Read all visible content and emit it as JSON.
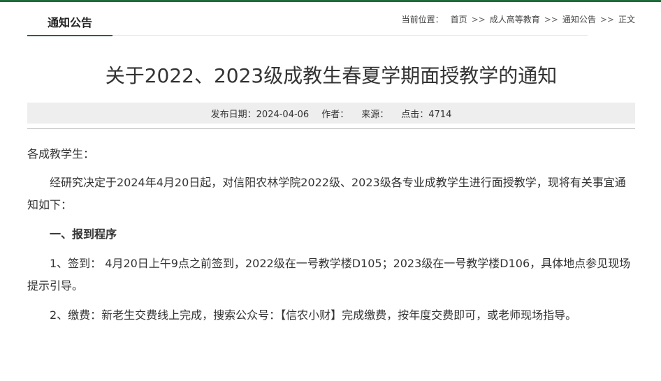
{
  "header": {
    "section_tab": "通知公告",
    "breadcrumb": {
      "prefix": "当前位置：",
      "items": [
        "首页",
        "成人高等教育",
        "通知公告",
        "正文"
      ],
      "separator": ">>"
    }
  },
  "article": {
    "title": "关于2022、2023级成教生春夏学期面授教学的通知",
    "meta": {
      "publish_date": "发布日期：2024-04-06",
      "author": "作者：",
      "source": "来源：",
      "clicks": "点击：4714"
    },
    "paragraphs": {
      "salutation": "各成教学生：",
      "intro": "经研究决定于2024年4月20日起，对信阳农林学院2022级、2023级各专业成教学生进行面授教学，现将有关事宜通知如下：",
      "heading1": "一、报到程序",
      "item1": "1、签到： 4月20日上午9点之前签到，2022级在一号教学楼D105；2023级在一号教学楼D106，具体地点参见现场提示引导。",
      "item2": "2、缴费：新老生交费线上完成，搜索公众号：【信农小财】完成缴费，按年度交费即可，或老师现场指导。"
    }
  },
  "colors": {
    "accent": "#1f6b3a",
    "meta_background": "#eeeeee",
    "text": "#333333"
  }
}
